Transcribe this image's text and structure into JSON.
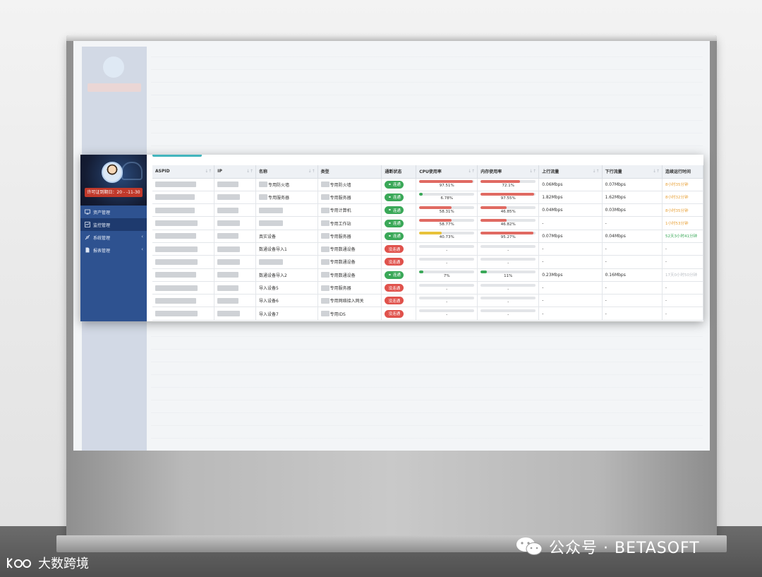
{
  "sidebar": {
    "license": "许可证到期日：20 - -11-30",
    "items": [
      {
        "label": "资产管理",
        "icon": "asset-icon"
      },
      {
        "label": "监控管理",
        "icon": "monitor-icon"
      },
      {
        "label": "系统管理",
        "icon": "system-icon"
      },
      {
        "label": "报表管理",
        "icon": "report-icon"
      }
    ]
  },
  "table": {
    "headers": [
      "ASPID",
      "IP",
      "名称",
      "类型",
      "通断状态",
      "CPU使用率",
      "内存使用率",
      "上行流量",
      "下行流量",
      "连续运行时间"
    ],
    "rows": [
      {
        "name": "专用防火墙",
        "type": "专用防火墙",
        "status": "连通",
        "online": true,
        "cpu": "97.51%",
        "cpu_val": 97.51,
        "mem": "72.1%",
        "mem_val": 72.1,
        "up": "0.06Mbps",
        "down": "0.07Mbps",
        "duration": "8小时35分钟",
        "dur_style": "warn"
      },
      {
        "name": "专用服务器",
        "type": "专用服务器",
        "status": "连通",
        "online": true,
        "cpu": "6.78%",
        "cpu_val": 6.78,
        "mem": "97.55%",
        "mem_val": 97.55,
        "up": "1.82Mbps",
        "down": "1.62Mbps",
        "duration": "8小时32分钟",
        "dur_style": "warn"
      },
      {
        "name": "",
        "type": "专用计算机",
        "status": "连通",
        "online": true,
        "cpu": "58.31%",
        "cpu_val": 58.31,
        "mem": "46.85%",
        "mem_val": 46.85,
        "up": "0.04Mbps",
        "down": "0.03Mbps",
        "duration": "8小时35分钟",
        "dur_style": "warn"
      },
      {
        "name": "",
        "type": "专用工作站",
        "status": "连通",
        "online": true,
        "cpu": "58.77%",
        "cpu_val": 58.77,
        "mem": "46.82%",
        "mem_val": 46.82,
        "up": "-",
        "down": "-",
        "duration": "1小时53分钟",
        "dur_style": "warn"
      },
      {
        "name": "真实设备",
        "type": "专用服务器",
        "status": "连通",
        "online": true,
        "cpu": "40.73%",
        "cpu_val": 40.73,
        "mem": "95.27%",
        "mem_val": 95.27,
        "up": "0.07Mbps",
        "down": "0.04Mbps",
        "duration": "52天3小时41分钟",
        "dur_style": "ok"
      },
      {
        "name": "数通设备导入1",
        "type": "专用数通设备",
        "status": "没连通",
        "online": false,
        "cpu": "-",
        "cpu_val": 0,
        "mem": "-",
        "mem_val": 0,
        "up": "-",
        "down": "-",
        "duration": "-",
        "dur_style": "plain"
      },
      {
        "name": "",
        "type": "专用数通设备",
        "status": "没连通",
        "online": false,
        "cpu": "-",
        "cpu_val": 0,
        "mem": "-",
        "mem_val": 0,
        "up": "-",
        "down": "-",
        "duration": "-",
        "dur_style": "plain"
      },
      {
        "name": "数通设备导入2",
        "type": "专用数通设备",
        "status": "连通",
        "online": true,
        "cpu": "7%",
        "cpu_val": 7,
        "mem": "11%",
        "mem_val": 11,
        "up": "0.23Mbps",
        "down": "0.16Mbps",
        "duration": "17天0小时50分钟",
        "dur_style": "dim"
      },
      {
        "name": "导入设备5",
        "type": "专用服务器",
        "status": "没连通",
        "online": false,
        "cpu": "-",
        "cpu_val": 0,
        "mem": "-",
        "mem_val": 0,
        "up": "-",
        "down": "-",
        "duration": "-",
        "dur_style": "plain"
      },
      {
        "name": "导入设备6",
        "type": "专用网络接入网关",
        "status": "没连通",
        "online": false,
        "cpu": "-",
        "cpu_val": 0,
        "mem": "-",
        "mem_val": 0,
        "up": "-",
        "down": "-",
        "duration": "-",
        "dur_style": "plain"
      },
      {
        "name": "导入设备7",
        "type": "专用IDS",
        "status": "没连通",
        "online": false,
        "cpu": "-",
        "cpu_val": 0,
        "mem": "-",
        "mem_val": 0,
        "up": "-",
        "down": "-",
        "duration": "-",
        "dur_style": "plain"
      }
    ]
  },
  "colors": {
    "sidebar": "#2e5290",
    "connected": "#3aa858",
    "disconnected": "#e0524c",
    "usage_high": "#e06a62",
    "usage_mid": "#e8c23a",
    "usage_low": "#3aa858",
    "duration_warn": "#e8a23a"
  },
  "watermark": {
    "left": "大数跨境",
    "right": "公众号 · BETASOFT"
  }
}
